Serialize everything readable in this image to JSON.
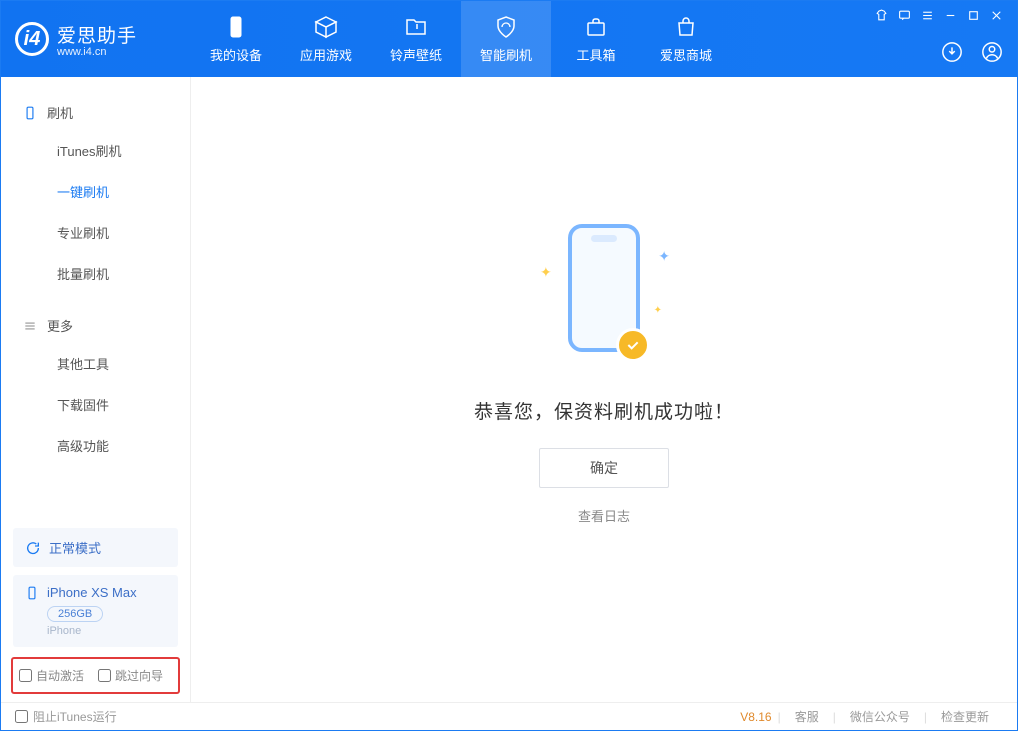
{
  "app": {
    "name": "爱思助手",
    "url": "www.i4.cn"
  },
  "nav": [
    {
      "label": "我的设备"
    },
    {
      "label": "应用游戏"
    },
    {
      "label": "铃声壁纸"
    },
    {
      "label": "智能刷机"
    },
    {
      "label": "工具箱"
    },
    {
      "label": "爱思商城"
    }
  ],
  "sidebar": {
    "group1": "刷机",
    "items1": [
      "iTunes刷机",
      "一键刷机",
      "专业刷机",
      "批量刷机"
    ],
    "group2": "更多",
    "items2": [
      "其他工具",
      "下载固件",
      "高级功能"
    ]
  },
  "mode": {
    "label": "正常模式"
  },
  "device": {
    "name": "iPhone XS Max",
    "capacity": "256GB",
    "type": "iPhone"
  },
  "opts": {
    "auto_activate": "自动激活",
    "skip_guide": "跳过向导"
  },
  "main": {
    "success": "恭喜您，保资料刷机成功啦！",
    "ok": "确定",
    "view_log": "查看日志"
  },
  "footer": {
    "block_itunes": "阻止iTunes运行",
    "version": "V8.16",
    "service": "客服",
    "wechat": "微信公众号",
    "check_update": "检查更新"
  }
}
